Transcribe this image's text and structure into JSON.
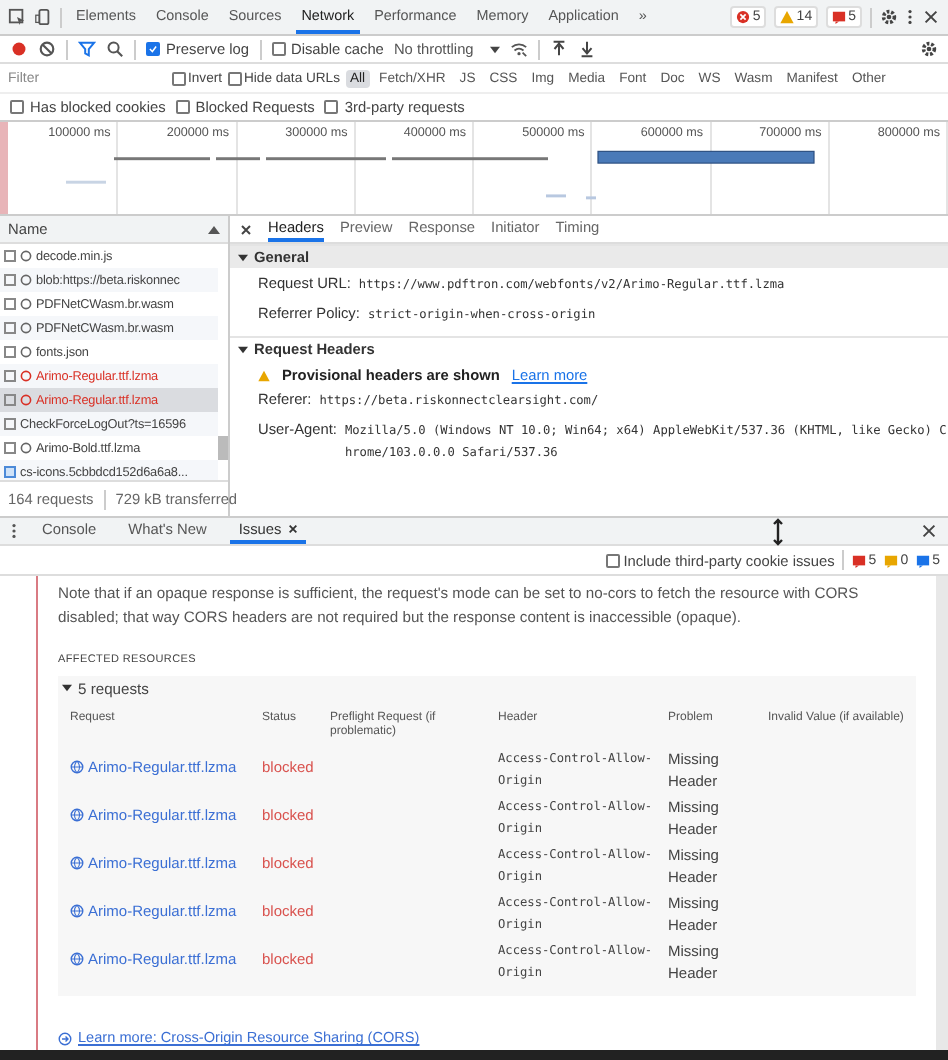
{
  "main_tabs": [
    {
      "label": "Elements",
      "selected": false
    },
    {
      "label": "Console",
      "selected": false
    },
    {
      "label": "Sources",
      "selected": false
    },
    {
      "label": "Network",
      "selected": true
    },
    {
      "label": "Performance",
      "selected": false
    },
    {
      "label": "Memory",
      "selected": false
    },
    {
      "label": "Application",
      "selected": false
    }
  ],
  "more_tabs": "»",
  "counts": [
    {
      "kind": "error",
      "count": "5"
    },
    {
      "kind": "warning",
      "count": "14"
    },
    {
      "kind": "issue",
      "count": "5"
    }
  ],
  "toolbar": {
    "recording": true,
    "checks": [
      {
        "label": "Preserve log",
        "checked": true
      },
      {
        "label": "Disable cache",
        "checked": false
      }
    ],
    "throttling": "No throttling"
  },
  "filter": {
    "placeholder": "Filter",
    "checks": [
      {
        "label": "Invert",
        "checked": false
      },
      {
        "label": "Hide data URLs",
        "checked": false
      }
    ],
    "types": [
      {
        "label": "All",
        "selected": true
      },
      {
        "label": "Fetch/XHR",
        "selected": false
      },
      {
        "label": "JS",
        "selected": false
      },
      {
        "label": "CSS",
        "selected": false
      },
      {
        "label": "Img",
        "selected": false
      },
      {
        "label": "Media",
        "selected": false
      },
      {
        "label": "Font",
        "selected": false
      },
      {
        "label": "Doc",
        "selected": false
      },
      {
        "label": "WS",
        "selected": false
      },
      {
        "label": "Wasm",
        "selected": false
      },
      {
        "label": "Manifest",
        "selected": false
      },
      {
        "label": "Other",
        "selected": false
      }
    ]
  },
  "extra_filters": [
    {
      "label": "Has blocked cookies",
      "checked": false
    },
    {
      "label": "Blocked Requests",
      "checked": false
    },
    {
      "label": "3rd-party requests",
      "checked": false
    }
  ],
  "overview": {
    "ticks": [
      "100000 ms",
      "200000 ms",
      "300000 ms",
      "400000 ms",
      "500000 ms",
      "600000 ms",
      "700000 ms",
      "800000 ms"
    ]
  },
  "requests": {
    "column": "Name",
    "items": [
      {
        "name": "decode.min.js",
        "kind": "pending",
        "failed": false,
        "selected": false
      },
      {
        "name": "blob:https://beta.riskonnec",
        "kind": "pending",
        "failed": false,
        "selected": false
      },
      {
        "name": "PDFNetCWasm.br.wasm",
        "kind": "pending",
        "failed": false,
        "selected": false
      },
      {
        "name": "PDFNetCWasm.br.wasm",
        "kind": "pending",
        "failed": false,
        "selected": false
      },
      {
        "name": "fonts.json",
        "kind": "pending",
        "failed": false,
        "selected": false
      },
      {
        "name": "Arimo-Regular.ttf.lzma",
        "kind": "pending",
        "failed": true,
        "selected": false
      },
      {
        "name": "Arimo-Regular.ttf.lzma",
        "kind": "pending",
        "failed": true,
        "selected": true
      },
      {
        "name": "CheckForceLogOut?ts=16596",
        "kind": "plain",
        "failed": false,
        "selected": false
      },
      {
        "name": "Arimo-Bold.ttf.lzma",
        "kind": "pending",
        "failed": false,
        "selected": false
      },
      {
        "name": "cs-icons.5cbbdcd152d6a6a8...",
        "kind": "image",
        "failed": false,
        "selected": false
      }
    ],
    "summary": [
      "164 requests",
      "729 kB transferred"
    ]
  },
  "details": {
    "tabs": [
      {
        "label": "Headers",
        "selected": true
      },
      {
        "label": "Preview",
        "selected": false
      },
      {
        "label": "Response",
        "selected": false
      },
      {
        "label": "Initiator",
        "selected": false
      },
      {
        "label": "Timing",
        "selected": false
      }
    ],
    "general": {
      "title": "General",
      "expanded": true,
      "rows": [
        {
          "key": "Request URL:",
          "value": "https://www.pdftron.com/webfonts/v2/Arimo-Regular.ttf.lzma"
        },
        {
          "key": "Referrer Policy:",
          "value": "strict-origin-when-cross-origin"
        }
      ]
    },
    "request_headers": {
      "title": "Request Headers",
      "expanded": true,
      "warning": "Provisional headers are shown",
      "link": "Learn more",
      "rows": [
        {
          "key": "Referer:",
          "value": "https://beta.riskonnectclearsight.com/"
        },
        {
          "key": "User-Agent:",
          "value": "Mozilla/5.0 (Windows NT 10.0; Win64; x64) AppleWebKit/537.36 (KHTML, like Gecko) Chrome/103.0.0.0 Safari/537.36"
        }
      ]
    }
  },
  "drawer": {
    "tabs": [
      {
        "label": "Console",
        "selected": false,
        "closable": false
      },
      {
        "label": "What's New",
        "selected": false,
        "closable": false
      },
      {
        "label": "Issues",
        "selected": true,
        "closable": true
      }
    ]
  },
  "issues": {
    "third_party": {
      "label": "Include third-party cookie issues",
      "checked": false
    },
    "counts": [
      {
        "kind": "error",
        "count": "5"
      },
      {
        "kind": "warning",
        "count": "0"
      },
      {
        "kind": "info",
        "count": "5"
      }
    ],
    "note": "Note that if an opaque response is sufficient, the request's mode can be set to no-cors to fetch the resource with CORS disabled; that way CORS headers are not required but the response content is inaccessible (opaque).",
    "affected_title": "AFFECTED RESOURCES",
    "group": {
      "label": "5 requests",
      "expanded": true
    },
    "columns": [
      "Request",
      "Status",
      "Preflight Request (if problematic)",
      "Header",
      "Problem",
      "Invalid Value (if available)"
    ],
    "rows": [
      {
        "request": "Arimo-Regular.ttf.lzma",
        "status": "blocked",
        "header": "Access-Control-Allow-Origin",
        "problem": "Missing Header"
      },
      {
        "request": "Arimo-Regular.ttf.lzma",
        "status": "blocked",
        "header": "Access-Control-Allow-Origin",
        "problem": "Missing Header"
      },
      {
        "request": "Arimo-Regular.ttf.lzma",
        "status": "blocked",
        "header": "Access-Control-Allow-Origin",
        "problem": "Missing Header"
      },
      {
        "request": "Arimo-Regular.ttf.lzma",
        "status": "blocked",
        "header": "Access-Control-Allow-Origin",
        "problem": "Missing Header"
      },
      {
        "request": "Arimo-Regular.ttf.lzma",
        "status": "blocked",
        "header": "Access-Control-Allow-Origin",
        "problem": "Missing Header"
      }
    ],
    "link": "Learn more: Cross-Origin Resource Sharing (CORS)"
  }
}
